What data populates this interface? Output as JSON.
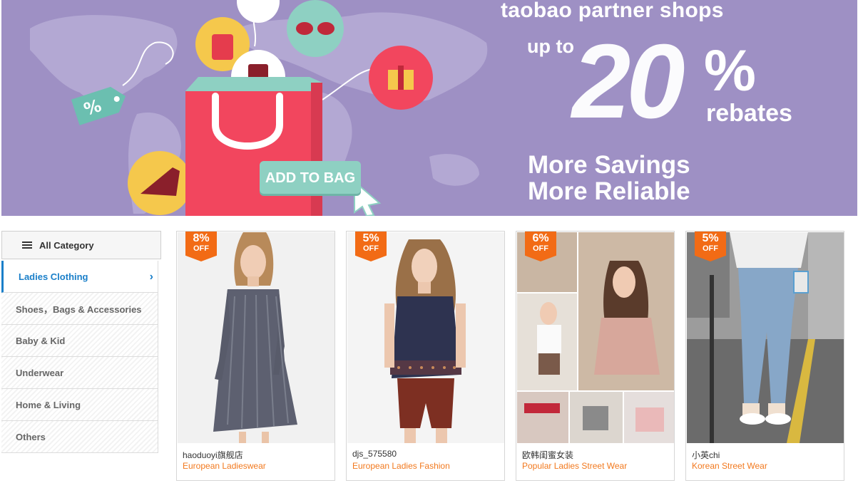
{
  "banner": {
    "headline": "taobao partner shops",
    "up_to": "up to",
    "percent_number": "20",
    "percent_sign": "%",
    "rebates": "rebates",
    "line1": "More Savings",
    "line2": "More Reliable",
    "cta": "ADD TO BAG",
    "tag_symbol": "%",
    "colors": {
      "background": "#9e90c4",
      "bag": "#f2465e",
      "button": "#8ed0c2"
    }
  },
  "sidebar": {
    "header_label": "All Category",
    "items": [
      {
        "label": "Ladies Clothing",
        "active": true
      },
      {
        "label": "Shoes，Bags & Accessories",
        "active": false
      },
      {
        "label": "Baby & Kid",
        "active": false
      },
      {
        "label": "Underwear",
        "active": false
      },
      {
        "label": "Home & Living",
        "active": false
      },
      {
        "label": "Others",
        "active": false
      }
    ]
  },
  "products": [
    {
      "discount": "8%",
      "off": "OFF",
      "shop": "haoduoyi旗舰店",
      "desc": "European Ladieswear"
    },
    {
      "discount": "5%",
      "off": "OFF",
      "shop": "djs_575580",
      "desc": "European Ladies Fashion"
    },
    {
      "discount": "6%",
      "off": "OFF",
      "shop": "欧韩闺蜜女装",
      "desc": "Popular Ladies Street Wear"
    },
    {
      "discount": "5%",
      "off": "OFF",
      "shop": "小英chi",
      "desc": "Korean Street Wear"
    }
  ],
  "colors": {
    "accent_blue": "#1a7fc9",
    "accent_orange": "#f2791e",
    "badge": "#f26b15"
  }
}
